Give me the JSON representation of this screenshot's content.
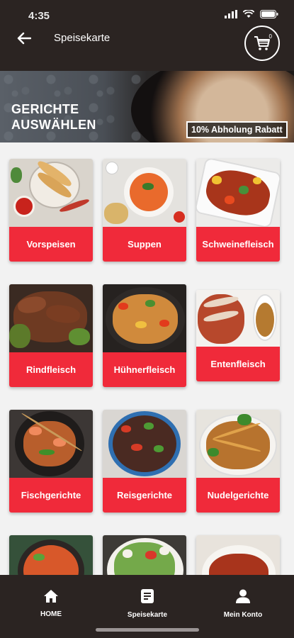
{
  "status_bar": {
    "time": "4:35"
  },
  "header": {
    "title": "Speisekarte",
    "cart_count": "0",
    "back_icon": "arrow-left-icon",
    "cart_icon": "shopping-cart-icon"
  },
  "banner": {
    "heading_line1": "GERICHTE",
    "heading_line2": "AUSWÄHLEN",
    "badge": "10% Abholung Rabatt"
  },
  "categories": [
    {
      "label": "Vorspeisen"
    },
    {
      "label": "Suppen"
    },
    {
      "label": "Schweinefleisch"
    },
    {
      "label": "Rindfleisch"
    },
    {
      "label": "Hühnerfleisch"
    },
    {
      "label": "Entenfleisch"
    },
    {
      "label": "Fischgerichte"
    },
    {
      "label": "Reisgerichte"
    },
    {
      "label": "Nudelgerichte"
    },
    {
      "label": ""
    },
    {
      "label": ""
    },
    {
      "label": ""
    }
  ],
  "bottom_nav": [
    {
      "label": "HOME",
      "icon": "home-icon"
    },
    {
      "label": "Speisekarte",
      "icon": "menu-icon"
    },
    {
      "label": "Mein Konto",
      "icon": "user-icon"
    }
  ],
  "colors": {
    "header_bg": "#2b2422",
    "accent": "#f02a3a",
    "page_bg": "#f2f2f2"
  }
}
